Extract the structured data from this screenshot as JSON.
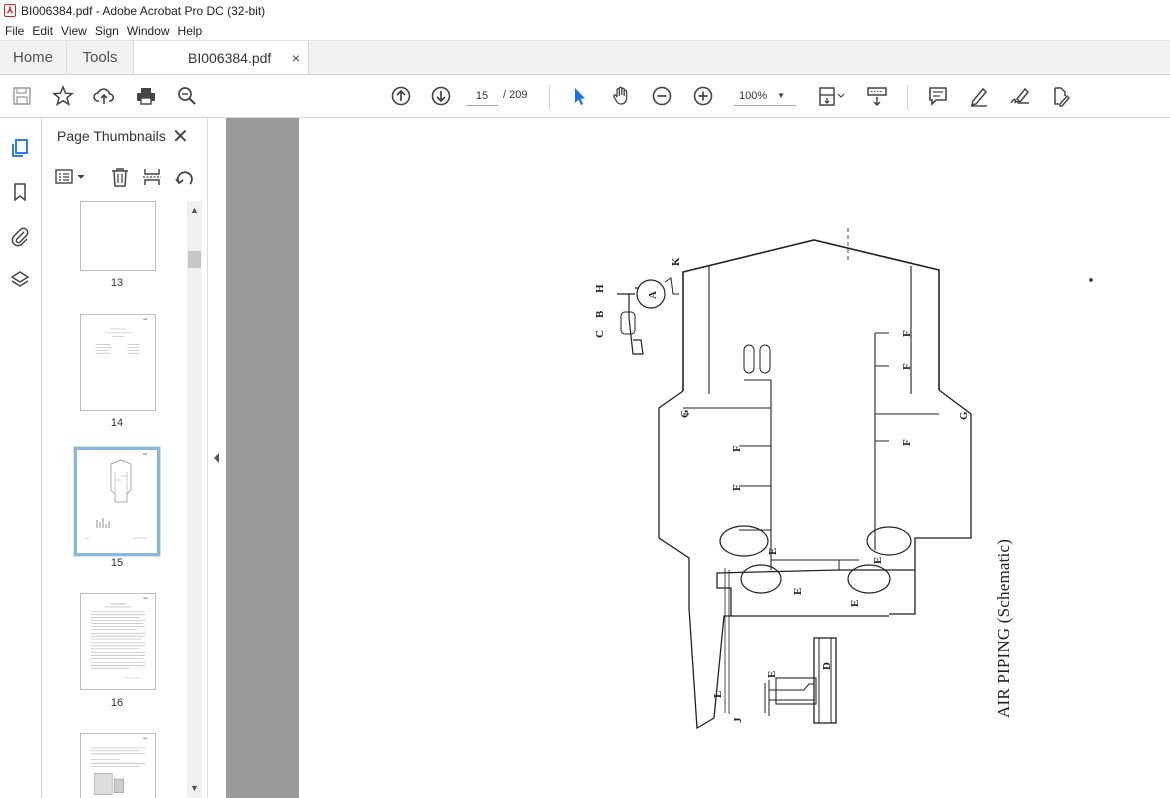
{
  "window": {
    "title": "BI006384.pdf - Adobe Acrobat Pro DC (32-bit)"
  },
  "menu": {
    "file": "File",
    "edit": "Edit",
    "view": "View",
    "sign": "Sign",
    "window": "Window",
    "help": "Help"
  },
  "tabs": {
    "home": "Home",
    "tools": "Tools",
    "document": "BI006384.pdf",
    "close": "×"
  },
  "toolbar": {
    "current_page": "15",
    "total_pages": "/ 209",
    "zoom": "100%"
  },
  "thumbnails": {
    "title": "Page Thumbnails",
    "close": "✕",
    "pages": [
      {
        "label": "13"
      },
      {
        "label": "14"
      },
      {
        "label": "15"
      },
      {
        "label": "16"
      }
    ],
    "selected_page": "15"
  },
  "page_content": {
    "caption": "AIR PIPING (Schematic)",
    "labels": [
      "A",
      "B",
      "C",
      "D",
      "E",
      "F",
      "G",
      "H",
      "J",
      "K",
      "L"
    ]
  },
  "colors": {
    "accent": "#1473e6",
    "selection": "#8ab7d6",
    "doc_bg": "#9a9a9a",
    "pdf_red": "#d2232a"
  }
}
